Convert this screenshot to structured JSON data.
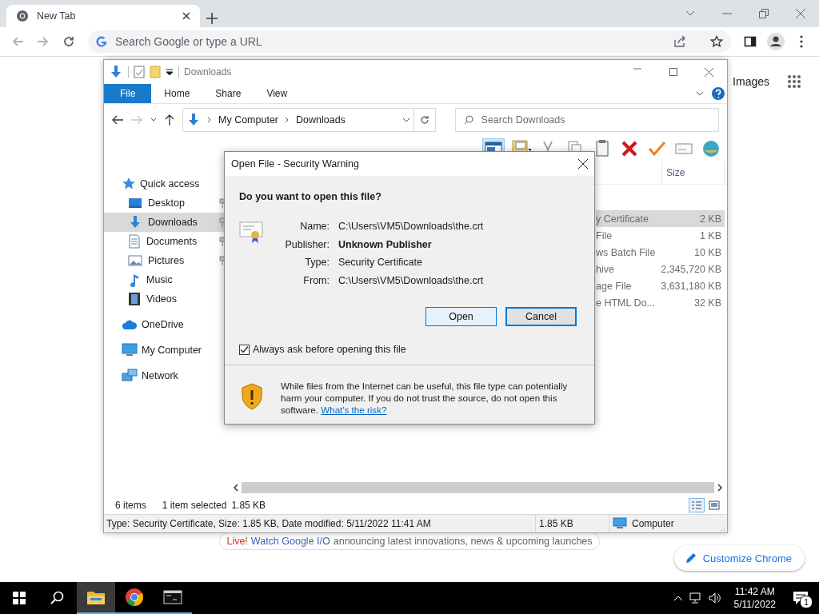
{
  "browser": {
    "tab": {
      "title": "New Tab",
      "selected": true
    },
    "nav_buttons": [
      {
        "kind": "back",
        "disabled": true
      },
      {
        "kind": "forward",
        "disabled": true
      },
      {
        "kind": "reload",
        "disabled": false
      }
    ],
    "omnibox": {
      "placeholder": "Search Google or type a URL"
    },
    "page": {
      "images_link": "Images",
      "promo": {
        "badge": "Live!",
        "link": "Watch Google I/O",
        "text": "announcing latest innovations, news & upcoming launches"
      },
      "customize_button": "Customize Chrome"
    }
  },
  "explorer": {
    "title": "Downloads",
    "ribbon_tabs": [
      {
        "label": "File",
        "selected": true
      },
      {
        "label": "Home",
        "selected": false
      },
      {
        "label": "Share",
        "selected": false
      },
      {
        "label": "View",
        "selected": false
      }
    ],
    "address": [
      "My Computer",
      "Downloads"
    ],
    "search": {
      "placeholder": "Search Downloads"
    },
    "toolbar": [
      {
        "kind": "preview-pane",
        "selected": true
      },
      {
        "kind": "checklist",
        "selected": false
      },
      {
        "kind": "cut",
        "selected": false
      },
      {
        "kind": "copy",
        "selected": false
      },
      {
        "kind": "paste",
        "selected": false
      },
      {
        "kind": "delete",
        "selected": false
      },
      {
        "kind": "check",
        "selected": false
      },
      {
        "kind": "envelope",
        "selected": false
      },
      {
        "kind": "globe",
        "selected": false
      }
    ],
    "nav_pane": [
      {
        "label": "Quick access",
        "kind": "star",
        "selected": false,
        "children": [
          {
            "label": "Desktop",
            "kind": "desktop",
            "pinned": true,
            "selected": false
          },
          {
            "label": "Downloads",
            "kind": "download",
            "pinned": true,
            "selected": true
          },
          {
            "label": "Documents",
            "kind": "document",
            "pinned": true,
            "selected": false
          },
          {
            "label": "Pictures",
            "kind": "pictures",
            "pinned": true,
            "selected": false
          },
          {
            "label": "Music",
            "kind": "music",
            "pinned": false,
            "selected": false
          },
          {
            "label": "Videos",
            "kind": "videos",
            "pinned": false,
            "selected": false
          }
        ]
      },
      {
        "label": "OneDrive",
        "kind": "cloud",
        "selected": false
      },
      {
        "label": "My Computer",
        "kind": "computer",
        "selected": false
      },
      {
        "label": "Network",
        "kind": "network",
        "selected": false
      }
    ],
    "columns": [
      "Size"
    ],
    "rows": [
      {
        "type": "y Certificate",
        "size": "2 KB",
        "selected": true
      },
      {
        "type": "File",
        "size": "1 KB",
        "selected": false
      },
      {
        "type": "ws Batch File",
        "size": "10 KB",
        "selected": false
      },
      {
        "type": "hive",
        "size": "2,345,720 KB",
        "selected": false
      },
      {
        "type": "age File",
        "size": "3,631,180 KB",
        "selected": false
      },
      {
        "type": "e HTML Do...",
        "size": "32 KB",
        "selected": false
      }
    ],
    "status": {
      "item_count": "6 items",
      "selection": "1 item selected",
      "selection_size": "1.85 KB"
    },
    "view_buttons": [
      {
        "kind": "details",
        "selected": true
      },
      {
        "kind": "large-icons",
        "selected": false
      }
    ],
    "details_bar": {
      "description": "Type: Security Certificate, Size: 1.85 KB, Date modified: 5/11/2022 11:41 AM",
      "size": "1.85 KB",
      "location": "Computer"
    }
  },
  "dialog": {
    "title": "Open File - Security Warning",
    "heading": "Do you want to open this file?",
    "fields": [
      {
        "label": "Name:",
        "value": "C:\\Users\\VM5\\Downloads\\the.crt",
        "bold": false
      },
      {
        "label": "Publisher:",
        "value": "Unknown Publisher",
        "bold": true
      },
      {
        "label": "Type:",
        "value": "Security Certificate",
        "bold": false
      },
      {
        "label": "From:",
        "value": "C:\\Users\\VM5\\Downloads\\the.crt",
        "bold": false
      }
    ],
    "buttons": [
      {
        "label": "Open",
        "highlighted": true,
        "focused": false
      },
      {
        "label": "Cancel",
        "highlighted": false,
        "focused": true
      }
    ],
    "checkbox": {
      "label": "Always ask before opening this file",
      "checked": true
    },
    "warning": {
      "text": "While files from the Internet can be useful, this file type can potentially harm your computer. If you do not trust the source, do not open this software.",
      "link": "What's the risk?"
    }
  },
  "taskbar": {
    "apps": [
      {
        "kind": "start",
        "running": false,
        "selected": false
      },
      {
        "kind": "search",
        "running": false,
        "selected": false
      },
      {
        "kind": "explorer",
        "running": true,
        "selected": true
      },
      {
        "kind": "chrome",
        "running": true,
        "selected": false
      },
      {
        "kind": "terminal",
        "running": true,
        "selected": false
      }
    ],
    "time": "11:42 AM",
    "date": "5/11/2022",
    "notification_count": "1"
  }
}
